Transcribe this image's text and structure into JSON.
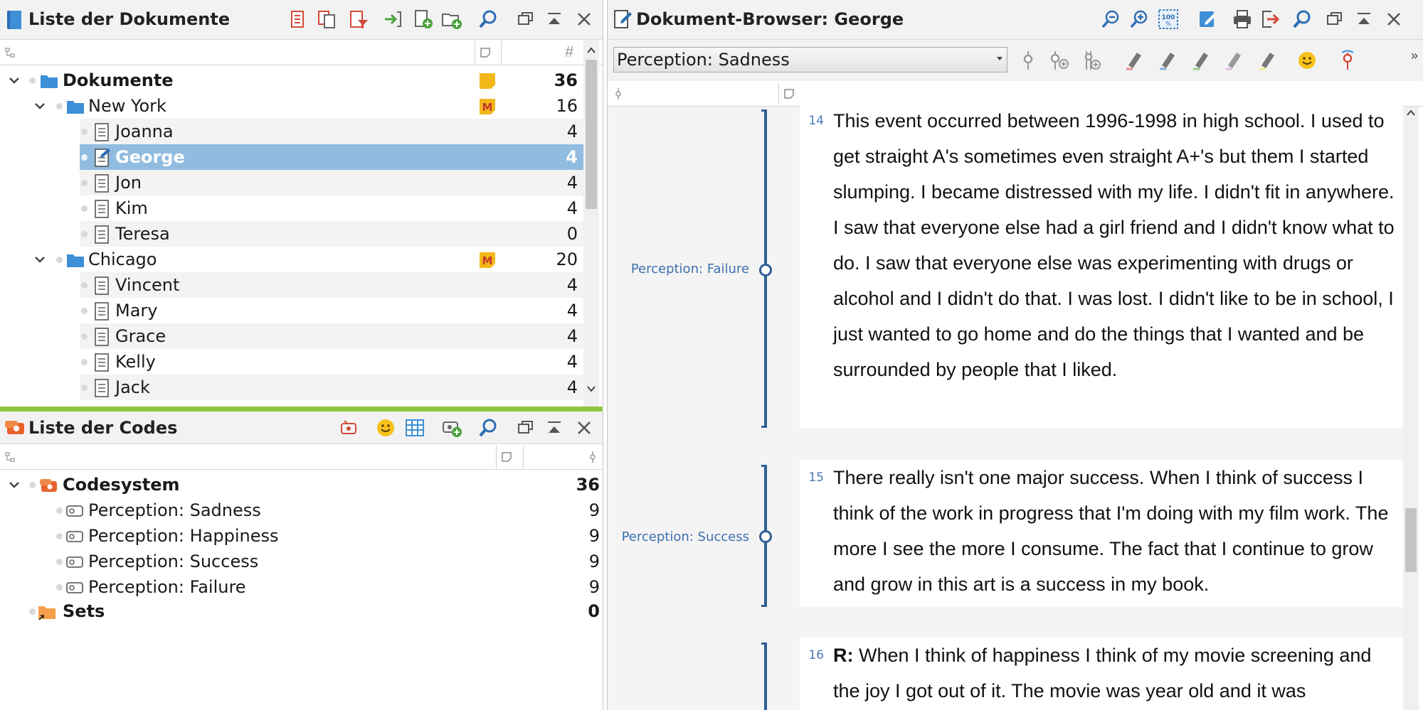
{
  "doc_list": {
    "title": "Liste der Dokumente",
    "rows": [
      {
        "label": "Dokumente",
        "count": "36",
        "bold": true
      },
      {
        "label": "New York",
        "count": "16"
      },
      {
        "label": "Joanna",
        "count": "4"
      },
      {
        "label": "George",
        "count": "4"
      },
      {
        "label": "Jon",
        "count": "4"
      },
      {
        "label": "Kim",
        "count": "4"
      },
      {
        "label": "Teresa",
        "count": "0"
      },
      {
        "label": "Chicago",
        "count": "20"
      },
      {
        "label": "Vincent",
        "count": "4"
      },
      {
        "label": "Mary",
        "count": "4"
      },
      {
        "label": "Grace",
        "count": "4"
      },
      {
        "label": "Kelly",
        "count": "4"
      },
      {
        "label": "Jack",
        "count": "4"
      }
    ],
    "header_hash": "#",
    "memo_badge": "M"
  },
  "code_list": {
    "title": "Liste der Codes",
    "rows": [
      {
        "label": "Codesystem",
        "count": "36"
      },
      {
        "label": "Perception: Sadness",
        "count": "9"
      },
      {
        "label": "Perception: Happiness",
        "count": "9"
      },
      {
        "label": "Perception: Success",
        "count": "9"
      },
      {
        "label": "Perception: Failure",
        "count": "9"
      },
      {
        "label": "Sets",
        "count": "0"
      }
    ]
  },
  "doc_browser": {
    "title": "Dokument-Browser: George",
    "selected_code": "Perception: Sadness",
    "overflow": "»",
    "paragraphs": [
      {
        "num": "14",
        "code": "Perception: Failure",
        "text": "This event occurred between 1996-1998 in high school. I used to get straight A's sometimes even straight A+'s but them I started slumping. I became distressed with my life. I didn't fit in anywhere. I saw that everyone else had a girl friend and I didn't know what to do. I saw that everyone else was experimenting with drugs or alcohol and I didn't do that. I was lost. I didn't like to be in school, I just wanted to go home and do the things that I wanted and be surrounded by people that I liked."
      },
      {
        "num": "15",
        "code": "Perception: Success",
        "text": "There really isn't one major success. When I think of success I think of the work in progress that I'm doing with my film work. The more I see the more I consume. The fact that I continue to grow and grow in this art is a success in my book."
      },
      {
        "num": "16",
        "speaker": "R:",
        "text": "When I think of happiness I think of my movie screening and the joy I got out of it. The movie was year old and it was"
      }
    ]
  },
  "colors": {
    "accent_green": "#8dc63f",
    "selection": "#91bce0",
    "code_line": "#2f5f96",
    "memo_yellow": "#f2b81a",
    "folder_blue": "#3d8fd6"
  }
}
